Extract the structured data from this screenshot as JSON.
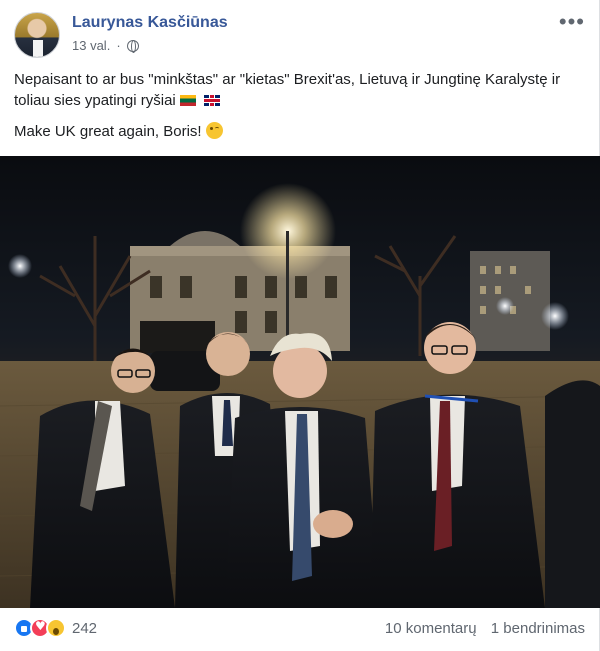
{
  "post": {
    "author": "Laurynas Kasčiūnas",
    "time": "13 val.",
    "separator": "·",
    "privacy_icon": "globe-icon",
    "more_icon": "more-horizontal-icon",
    "paragraphs": [
      "Nepaisant to ar bus \"minkštas\" ar \"kietas\" Brexit'as, Lietuvą ir Jungtinę Karalystę ir toliau sies ypatingi ryšiai",
      "Make UK great again, Boris!"
    ],
    "flags": [
      "lithuania-flag-icon",
      "uk-flag-icon"
    ],
    "emoji": "winking-face-icon"
  },
  "footer": {
    "reaction_icons": [
      "like-icon",
      "love-icon",
      "wow-icon"
    ],
    "reaction_count": "242",
    "comments": "10 komentarų",
    "shares": "1 bendrinimas"
  },
  "colors": {
    "author_link": "#385898",
    "meta_text": "#606770",
    "like": "#1877f2",
    "love": "#f33e58",
    "wow": "#f7c531"
  }
}
